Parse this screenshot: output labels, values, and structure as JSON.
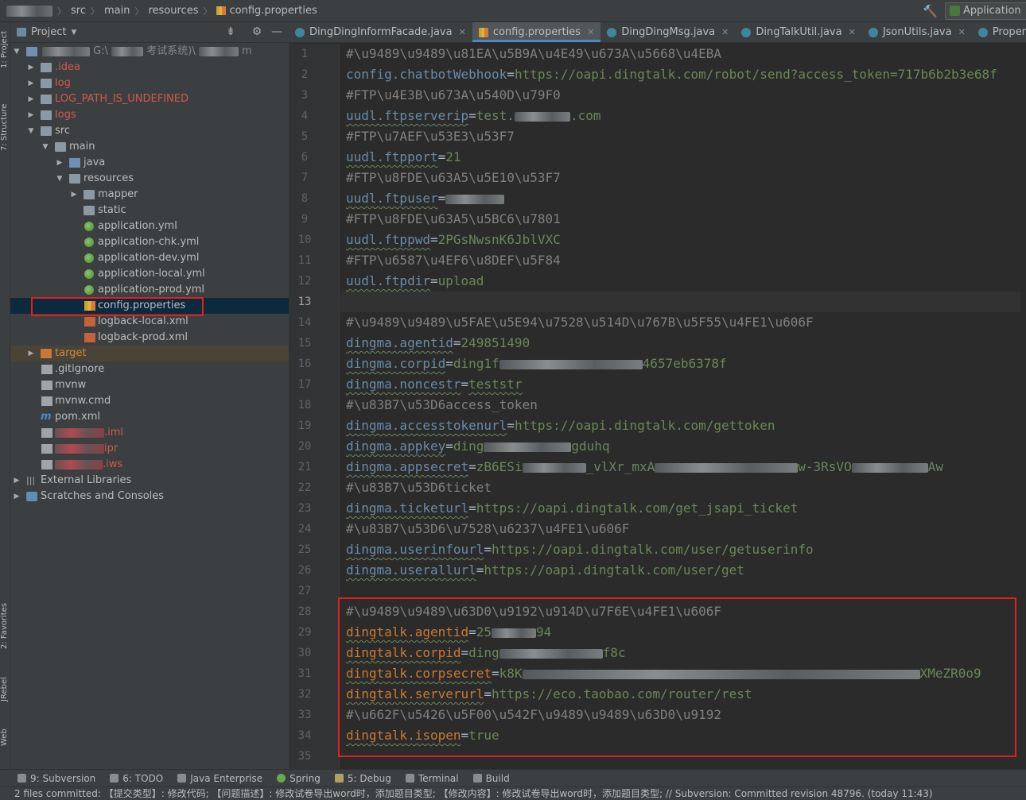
{
  "breadcrumb": {
    "items": [
      "src",
      "main",
      "resources",
      "config.properties"
    ]
  },
  "run_config": {
    "label": "Application"
  },
  "side_tabs": {
    "project": "1: Project",
    "structure": "7: Structure",
    "favorites": "2: Favorites",
    "jrebel": "JRebel",
    "web": "Web"
  },
  "project_panel": {
    "title": "Project",
    "root_path": "G:\\",
    "root_suffix": "考试系统)\\",
    "root_end": "m",
    "tree": {
      "idea": ".idea",
      "log": "log",
      "log_path": "LOG_PATH_IS_UNDEFINED",
      "logs": "logs",
      "src": "src",
      "main": "main",
      "java": "java",
      "resources": "resources",
      "mapper": "mapper",
      "static": "static",
      "app_yml": "application.yml",
      "app_chk": "application-chk.yml",
      "app_dev": "application-dev.yml",
      "app_local": "application-local.yml",
      "app_prod": "application-prod.yml",
      "config": "config.properties",
      "logback_local": "logback-local.xml",
      "logback_prod": "logback-prod.xml",
      "target": "target",
      "gitignore": ".gitignore",
      "mvnw": "mvnw",
      "mvnw_cmd": "mvnw.cmd",
      "pom": "pom.xml",
      "iml": ".iml",
      "ipr": "ipr",
      "iws": ".iws",
      "ext_libs": "External Libraries",
      "scratches": "Scratches and Consoles"
    }
  },
  "tabs": [
    {
      "label": "DingDingInformFacade.java",
      "icon": "java-class-icon"
    },
    {
      "label": "config.properties",
      "icon": "properties-icon",
      "active": true
    },
    {
      "label": "DingDingMsg.java",
      "icon": "java-class-icon"
    },
    {
      "label": "DingTalkUtil.java",
      "icon": "java-class-icon"
    },
    {
      "label": "JsonUtils.java",
      "icon": "java-class-icon"
    },
    {
      "label": "PropertiesUtil.java",
      "icon": "java-class-icon"
    }
  ],
  "editor": {
    "current_line": 13,
    "lines": {
      "l1": "#\\u9489\\u9489\\u81EA\\u5B9A\\u4E49\\u673A\\u5668\\u4EBA",
      "l2k": "config.chatbotWebhook",
      "l2v": "https://oapi.dingtalk.com/robot/send?access_token=717b6b2b3e68f",
      "l3": "#FTP\\u4E3B\\u673A\\u540D\\u79F0",
      "l4k": "uudl.ftpserverip",
      "l4v": "test.",
      "l4v2": ".com",
      "l5": "#FTP\\u7AEF\\u53E3\\u53F7",
      "l6k": "uudl.ftpport",
      "l6v": "21",
      "l7": "#FTP\\u8FDE\\u63A5\\u5E10\\u53F7",
      "l8k": "uudl.ftpuser",
      "l9": "#FTP\\u8FDE\\u63A5\\u5BC6\\u7801",
      "l10k": "uudl.ftppwd",
      "l10v": "2PGsNwsnK6JblVXC",
      "l11": "#FTP\\u6587\\u4EF6\\u8DEF\\u5F84",
      "l12k": "uudl.ftpdir",
      "l12v": "upload",
      "l14": "#\\u9489\\u9489\\u5FAE\\u5E94\\u7528\\u514D\\u767B\\u5F55\\u4FE1\\u606F",
      "l15k": "dingma.agentid",
      "l15v": "249851490",
      "l16k": "dingma.corpid",
      "l16v": "ding1f",
      "l16v2": "4657eb6378f",
      "l17k": "dingma.noncestr",
      "l17v": "teststr",
      "l18": "#\\u83B7\\u53D6access_token",
      "l19k": "dingma.accesstokenurl",
      "l19v": "https://oapi.dingtalk.com/gettoken",
      "l20k": "dingma.appkey",
      "l20v": "ding",
      "l20v2": "gduhq",
      "l21k": "dingma.appsecret",
      "l21v": "zB6ESi",
      "l21v2": "_vlXr_mxA",
      "l21v3": "w-3RsVO",
      "l21v4": "Aw",
      "l22": "#\\u83B7\\u53D6ticket",
      "l23k": "dingma.ticketurl",
      "l23v": "https://oapi.dingtalk.com/get_jsapi_ticket",
      "l24": "#\\u83B7\\u53D6\\u7528\\u6237\\u4FE1\\u606F",
      "l25k": "dingma.userinfourl",
      "l25v": "https://oapi.dingtalk.com/user/getuserinfo",
      "l26k": "dingma.userallurl",
      "l26v": "https://oapi.dingtalk.com/user/get",
      "l28": "#\\u9489\\u9489\\u63D0\\u9192\\u914D\\u7F6E\\u4FE1\\u606F",
      "l29k": "dingtalk.agentid",
      "l29v": "25",
      "l29v2": "94",
      "l30k": "dingtalk.corpid",
      "l30v": "ding",
      "l30v2": "f8c",
      "l31k": "dingtalk.corpsecret",
      "l31v": "k8K",
      "l31v2": "XMeZR0o9",
      "l32k": "dingtalk.serverurl",
      "l32v": "https://eco.taobao.com/router/rest",
      "l33": "#\\u662F\\u5426\\u5F00\\u542F\\u9489\\u9489\\u63D0\\u9192",
      "l34k": "dingtalk.isopen",
      "l34v": "true"
    }
  },
  "tool_windows": [
    "9: Subversion",
    "6: TODO",
    "Java Enterprise",
    "Spring",
    "5: Debug",
    "Terminal",
    "Build"
  ],
  "status": "2 files committed: 【提交类型】: 修改代码; 【问题描述】: 修改试卷导出word时，添加题目类型; 【修改内容】: 修改试卷导出word时，添加题目类型; // Subversion: Committed revision 48796. (today 11:43)"
}
